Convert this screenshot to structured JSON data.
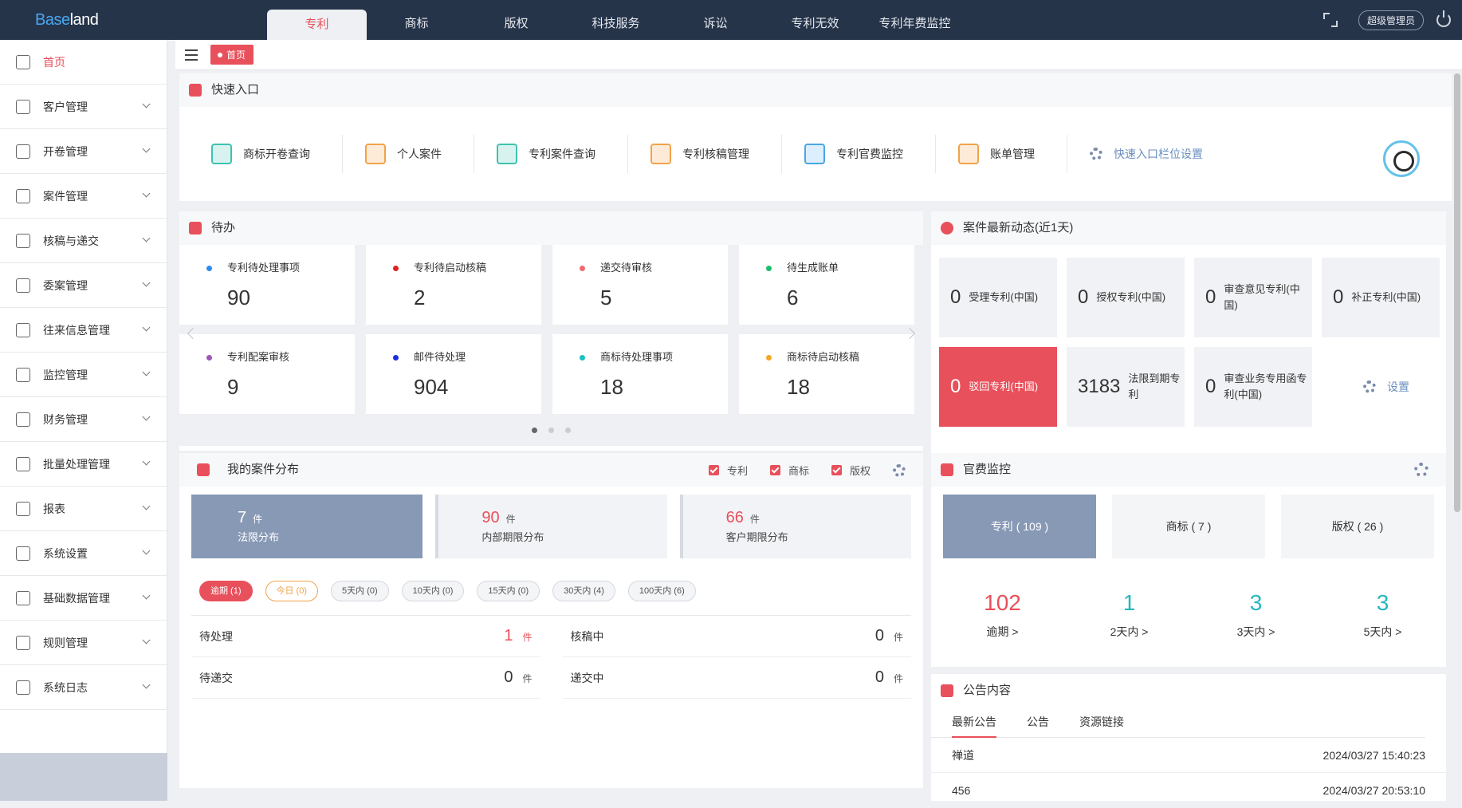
{
  "app": {
    "logo_left": "Base",
    "logo_right": "land"
  },
  "nav": {
    "tabs": [
      "专利",
      "商标",
      "版权",
      "科技服务",
      "诉讼",
      "专利无效",
      "专利年费监控"
    ],
    "active": 0,
    "admin_label": "超级管理员"
  },
  "sidebar": {
    "items": [
      {
        "label": "首页",
        "icon": "home-icon",
        "active": true
      },
      {
        "label": "客户管理",
        "icon": "users-icon"
      },
      {
        "label": "开卷管理",
        "icon": "file-icon"
      },
      {
        "label": "案件管理",
        "icon": "folder-icon"
      },
      {
        "label": "核稿与递交",
        "icon": "edit-icon"
      },
      {
        "label": "委案管理",
        "icon": "briefcase-icon"
      },
      {
        "label": "往来信息管理",
        "icon": "send-icon"
      },
      {
        "label": "监控管理",
        "icon": "location-icon"
      },
      {
        "label": "财务管理",
        "icon": "wallet-icon"
      },
      {
        "label": "批量处理管理",
        "icon": "list-icon"
      },
      {
        "label": "报表",
        "icon": "pie-icon"
      },
      {
        "label": "系统设置",
        "icon": "settings-icon"
      },
      {
        "label": "基础数据管理",
        "icon": "layers-icon"
      },
      {
        "label": "规则管理",
        "icon": "sliders-icon"
      },
      {
        "label": "系统日志",
        "icon": "log-icon"
      }
    ]
  },
  "breadcrumb": {
    "label": "首页"
  },
  "quick": {
    "title": "快速入口",
    "items": [
      "商标开卷查询",
      "个人案件",
      "专利案件查询",
      "专利核稿管理",
      "专利官费监控",
      "账单管理"
    ],
    "settings_label": "快速入口栏位设置"
  },
  "todo": {
    "title": "待办",
    "cards": [
      {
        "label": "专利待处理事项",
        "value": "90",
        "color": "#2d8cf0"
      },
      {
        "label": "专利待启动核稿",
        "value": "2",
        "color": "#e02020"
      },
      {
        "label": "递交待审核",
        "value": "5",
        "color": "#ef6b6b"
      },
      {
        "label": "待生成账单",
        "value": "6",
        "color": "#19be6b"
      },
      {
        "label": "专利配案审核",
        "value": "9",
        "color": "#9b59b6"
      },
      {
        "label": "邮件待处理",
        "value": "904",
        "color": "#1a2ee0"
      },
      {
        "label": "商标待处理事项",
        "value": "18",
        "color": "#19c2c2"
      },
      {
        "label": "商标待启动核稿",
        "value": "18",
        "color": "#f5a623"
      }
    ]
  },
  "dynamics": {
    "title": "案件最新动态(近1天)",
    "cards": [
      {
        "value": "0",
        "label": "受理专利(中国)"
      },
      {
        "value": "0",
        "label": "授权专利(中国)"
      },
      {
        "value": "0",
        "label": "审查意见专利(中国)"
      },
      {
        "value": "0",
        "label": "补正专利(中国)"
      },
      {
        "value": "0",
        "label": "驳回专利(中国)"
      },
      {
        "value": "3183",
        "label": "法限到期专利"
      },
      {
        "value": "0",
        "label": "审查业务专用函专利(中国)"
      }
    ],
    "settings_label": "设置"
  },
  "mycase": {
    "title": "我的案件分布",
    "checks": [
      "专利",
      "商标",
      "版权"
    ],
    "stats": [
      {
        "value": "7",
        "unit": "件",
        "label": "法限分布"
      },
      {
        "value": "90",
        "unit": "件",
        "label": "内部期限分布"
      },
      {
        "value": "66",
        "unit": "件",
        "label": "客户期限分布"
      }
    ],
    "pills": [
      "逾期 (1)",
      "今日 (0)",
      "5天内 (0)",
      "10天内 (0)",
      "15天内 (0)",
      "30天内 (4)",
      "100天内 (6)"
    ],
    "rows": [
      {
        "label": "待处理",
        "value": "1",
        "unit": "件"
      },
      {
        "label": "核稿中",
        "value": "0",
        "unit": "件"
      },
      {
        "label": "待递交",
        "value": "0",
        "unit": "件"
      },
      {
        "label": "递交中",
        "value": "0",
        "unit": "件"
      }
    ]
  },
  "fee": {
    "title": "官费监控",
    "tabs": [
      "专利 ( 109 )",
      "商标 ( 7 )",
      "版权 ( 26 )"
    ],
    "nums": [
      {
        "value": "102",
        "label": "逾期 >"
      },
      {
        "value": "1",
        "label": "2天内 >"
      },
      {
        "value": "3",
        "label": "3天内 >"
      },
      {
        "value": "3",
        "label": "5天内 >"
      }
    ]
  },
  "notice": {
    "title": "公告内容",
    "tabs": [
      "最新公告",
      "公告",
      "资源链接"
    ],
    "rows": [
      {
        "title": "禅道",
        "date": "2024/03/27 15:40:23"
      },
      {
        "title": "456",
        "date": "2024/03/27 20:53:10"
      }
    ]
  }
}
